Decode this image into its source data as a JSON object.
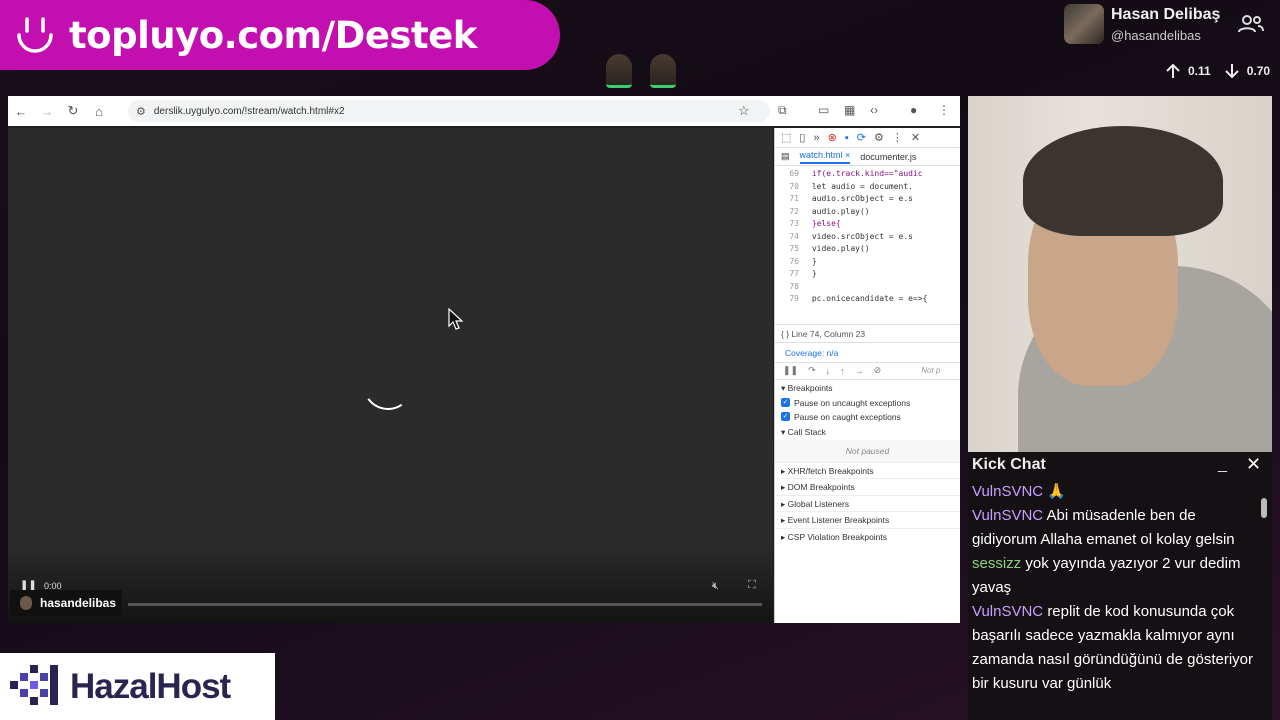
{
  "banner": {
    "url": "topluyo.com/Destek"
  },
  "streamer": {
    "name": "Hasan Delibaş",
    "handle": "@hasandelibas"
  },
  "stats": {
    "up": "0.11",
    "down": "0.70"
  },
  "browser": {
    "url": "derslik.uygulyo.com/!stream/watch.html#x2",
    "video_time": "0:00",
    "video_tag": "hasandelibas"
  },
  "devtools": {
    "tabs": [
      "watch.html",
      "documenter.js"
    ],
    "code_lines": [
      {
        "n": "69",
        "t": "      if(e.track.kind==\"audic"
      },
      {
        "n": "70",
        "t": "        let audio = document."
      },
      {
        "n": "71",
        "t": "        audio.srcObject = e.s"
      },
      {
        "n": "72",
        "t": "        audio.play()"
      },
      {
        "n": "73",
        "t": "      }else{"
      },
      {
        "n": "74",
        "t": "        video.srcObject = e.s"
      },
      {
        "n": "75",
        "t": "        video.play()"
      },
      {
        "n": "76",
        "t": "      }"
      },
      {
        "n": "77",
        "t": "    }"
      },
      {
        "n": "78",
        "t": ""
      },
      {
        "n": "79",
        "t": "    pc.onicecandidate = e=>{"
      }
    ],
    "status": "Line 74, Column 23",
    "coverage": "Coverage: n/a",
    "not_text": "Not p",
    "breakpoints_title": "Breakpoints",
    "pause_uncaught": "Pause on uncaught exceptions",
    "pause_caught": "Pause on caught exceptions",
    "call_stack": "Call Stack",
    "not_paused": "Not paused",
    "collapsed": [
      "XHR/fetch Breakpoints",
      "DOM Breakpoints",
      "Global Listeners",
      "Event Listener Breakpoints",
      "CSP Violation Breakpoints"
    ]
  },
  "chat": {
    "title": "Kick Chat",
    "messages": [
      {
        "user": "VulnSVNC",
        "text": "🙏",
        "green": false
      },
      {
        "user": "VulnSVNC",
        "text": "Abi müsadenle ben de gidiyorum Allaha emanet ol kolay gelsin",
        "green": false
      },
      {
        "user": "sessizz",
        "text": "yok yayında yazıyor 2 vur dedim yavaş",
        "green": true
      },
      {
        "user": "VulnSVNC",
        "text": "replit de kod konusunda çok başarılı sadece yazmakla kalmıyor aynı zamanda nasıl göründüğünü de gösteriyor bir kusuru var günlük",
        "green": false
      }
    ]
  },
  "sponsor": {
    "name": "HazalHost"
  },
  "colors": {
    "banner": "#c40fb0",
    "chat_user": "#c9a0ff",
    "chat_user_alt": "#8fd17a"
  }
}
